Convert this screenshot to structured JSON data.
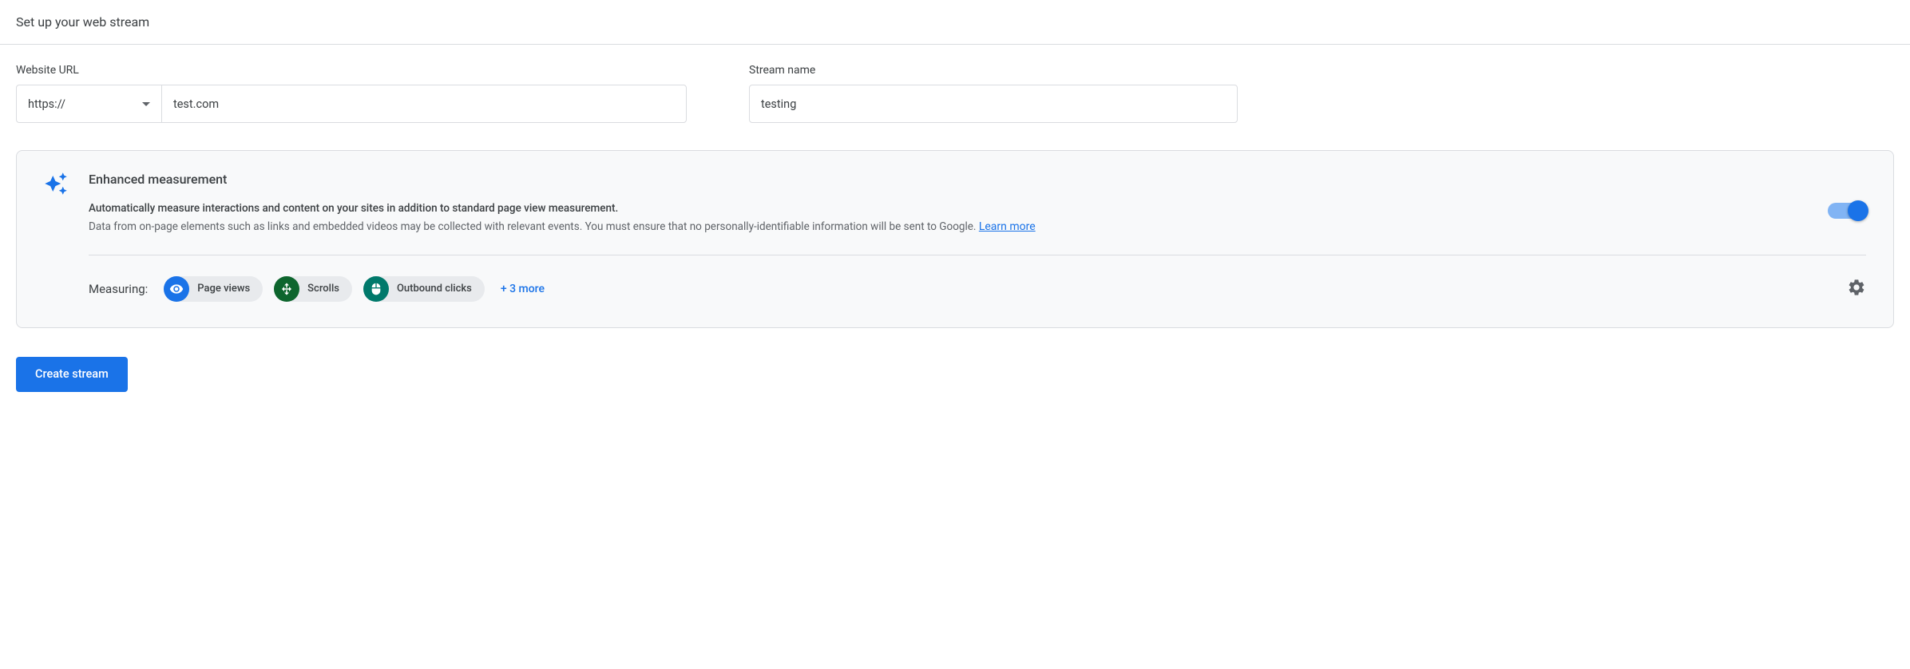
{
  "header": {
    "title": "Set up your web stream"
  },
  "fields": {
    "url_label": "Website URL",
    "protocol": "https://",
    "url_value": "test.com",
    "stream_label": "Stream name",
    "stream_value": "testing"
  },
  "card": {
    "title": "Enhanced measurement",
    "desc_bold": "Automatically measure interactions and content on your sites in addition to standard page view measurement.",
    "desc_rest": "Data from on-page elements such as links and embedded videos may be collected with relevant events. You must ensure that no personally-identifiable information will be sent to Google. ",
    "learn_more": "Learn more",
    "measuring_label": "Measuring:",
    "chips": {
      "page_views": "Page views",
      "scrolls": "Scrolls",
      "outbound": "Outbound clicks"
    },
    "more": "+ 3 more"
  },
  "actions": {
    "create": "Create stream"
  }
}
